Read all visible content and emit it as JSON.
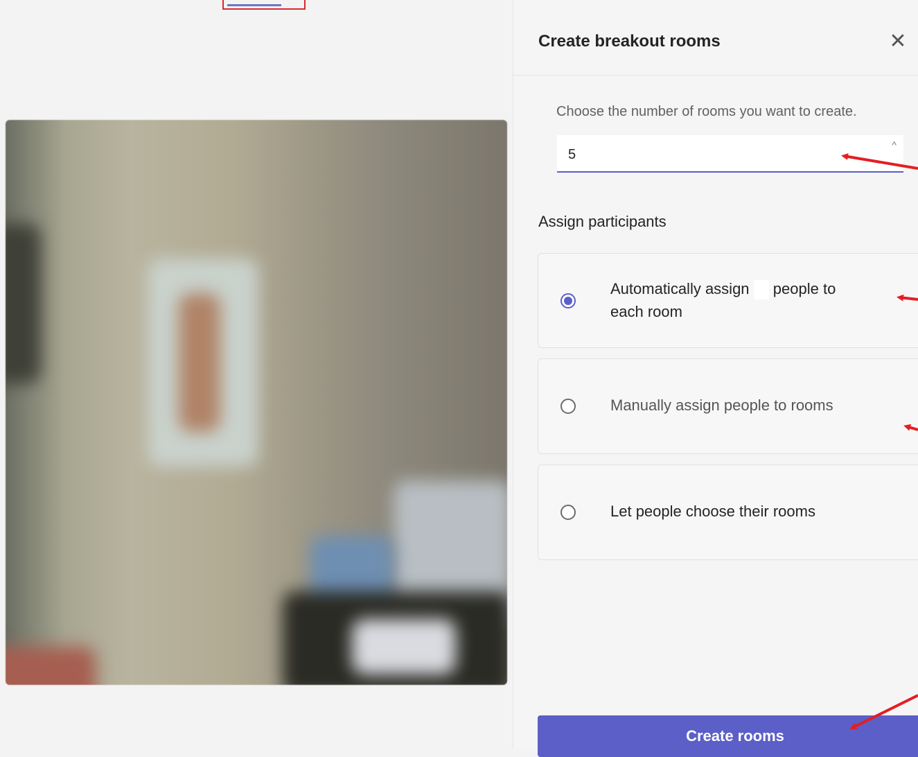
{
  "panel": {
    "title": "Create breakout rooms",
    "close_icon": "close-icon",
    "rooms_hint": "Choose the number of rooms you want to create.",
    "rooms_value": "5",
    "assign_label": "Assign participants",
    "options": [
      {
        "label_part1": "Automatically assign",
        "label_part2": "people to",
        "label_line2": "each room",
        "selected": true
      },
      {
        "label": "Manually assign people to rooms",
        "selected": false
      },
      {
        "label": "Let people choose their rooms",
        "selected": false
      }
    ],
    "create_button": "Create rooms"
  },
  "colors": {
    "accent": "#5b5fc7",
    "annotation": "#e31e24"
  }
}
